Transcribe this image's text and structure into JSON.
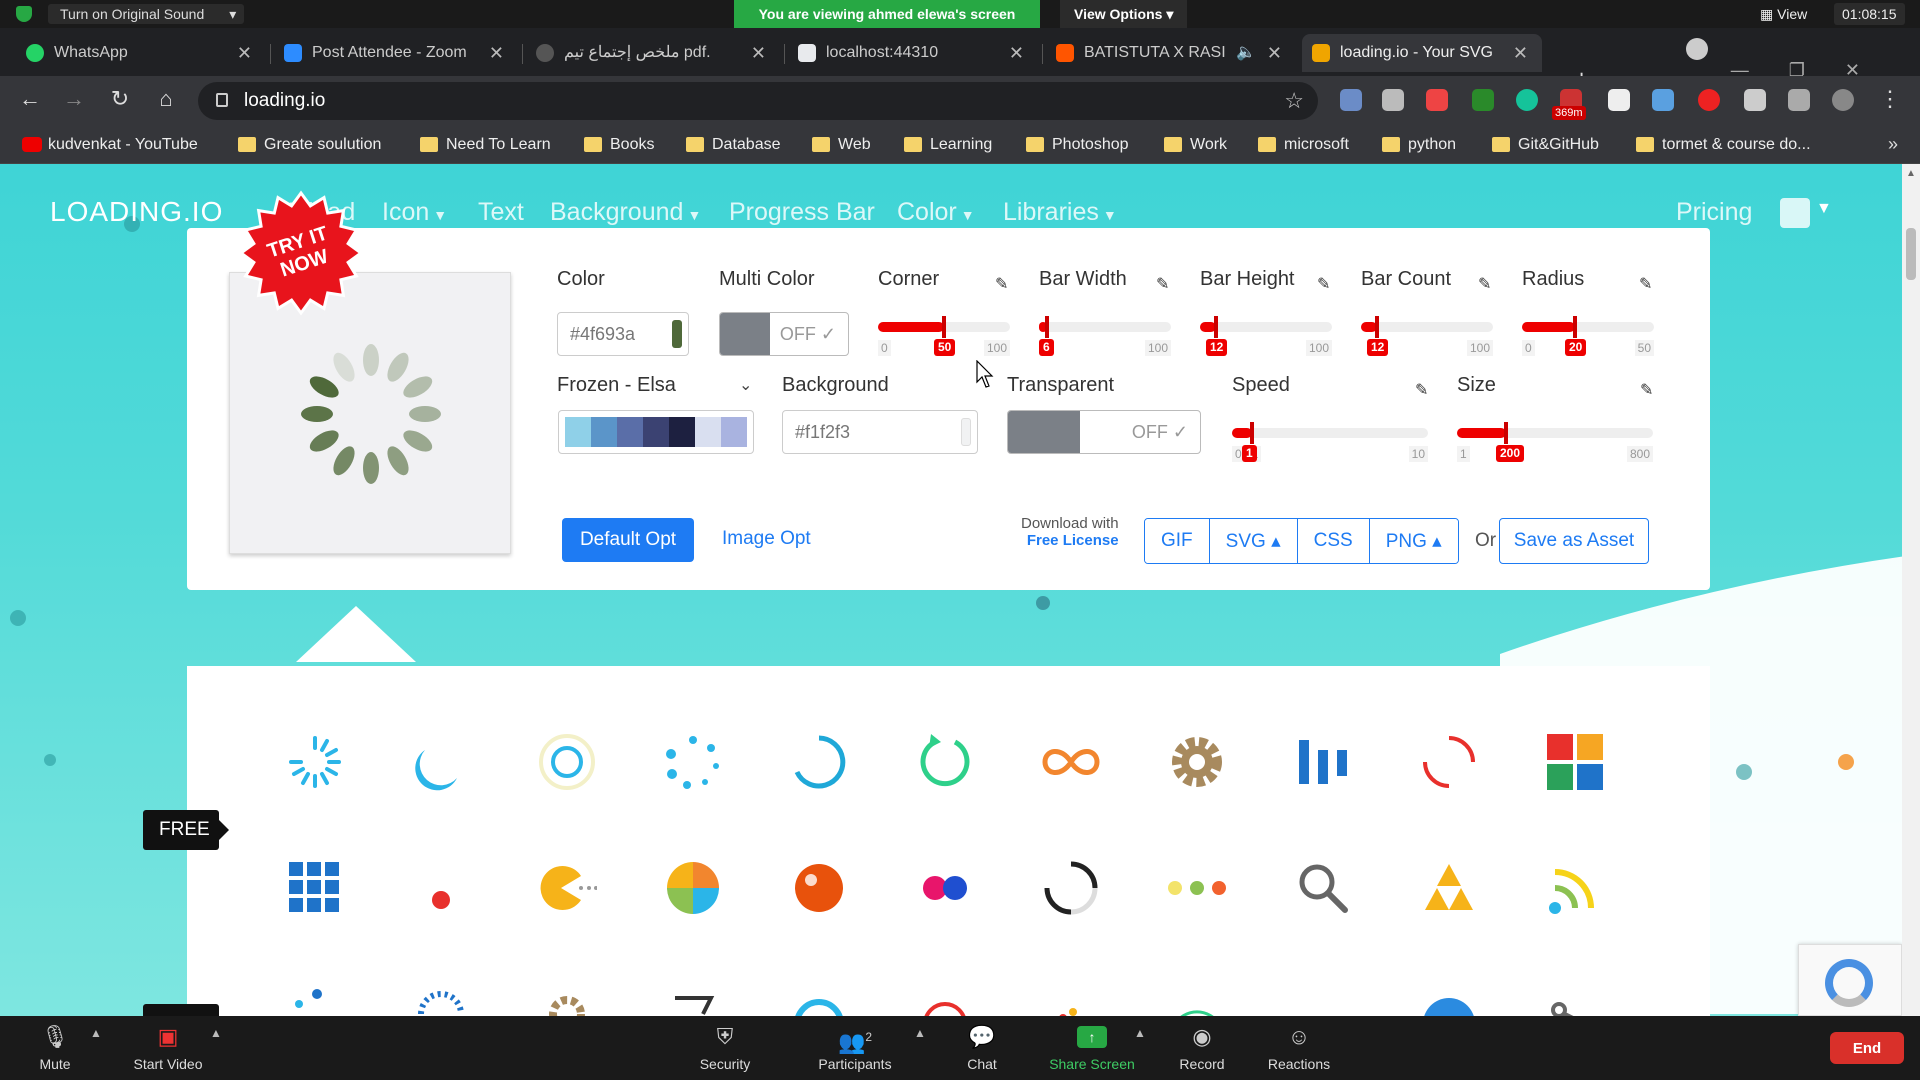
{
  "zoom_top": {
    "original_sound": "Turn on Original Sound",
    "viewing_banner": "You are viewing ahmed elewa's screen",
    "view_options": "View Options",
    "view": "View",
    "clock": "01:08:15"
  },
  "tabs": [
    {
      "label": "WhatsApp",
      "favicon_color": "#25d366"
    },
    {
      "label": "Post Attendee - Zoom",
      "favicon_color": "#2d8cff"
    },
    {
      "label": "ملخص إجتماع تيم pdf.",
      "favicon_color": "#555555"
    },
    {
      "label": "localhost:44310",
      "favicon_color": "#e8eaed"
    },
    {
      "label": "BATISTUTA X RASI",
      "favicon_color": "#ff5500"
    },
    {
      "label": "loading.io - Your SVG",
      "favicon_color": "#f0a500"
    }
  ],
  "address": {
    "url": "loading.io",
    "ext_badge": "369m"
  },
  "bookmarks": [
    "kudvenkat - YouTube",
    "Greate soulution",
    "Need To Learn",
    "Books",
    "Database",
    "Web",
    "Learning",
    "Photoshop",
    "Work",
    "microsoft",
    "python",
    "Git&GitHub",
    "tormet & course do..."
  ],
  "site": {
    "logo": "LOADING.IO",
    "nav": [
      "Upload",
      "Icon",
      "Text",
      "Background",
      "Progress Bar",
      "Color",
      "Libraries"
    ],
    "pricing": "Pricing",
    "try_badge_l1": "TRY IT",
    "try_badge_l2": "NOW"
  },
  "editor": {
    "color_label": "Color",
    "color_value": "#4f693a",
    "multicolor_label": "Multi Color",
    "multicolor_value": "OFF",
    "corner": {
      "label": "Corner",
      "min": "0",
      "max": "100",
      "value": "50",
      "level": 0.5
    },
    "bar_width": {
      "label": "Bar Width",
      "min": "",
      "max": "100",
      "value": "6",
      "level": 0.06
    },
    "bar_height": {
      "label": "Bar Height",
      "min": "",
      "max": "100",
      "value": "12",
      "level": 0.12
    },
    "bar_count": {
      "label": "Bar Count",
      "min": "",
      "max": "100",
      "value": "12",
      "level": 0.12
    },
    "radius": {
      "label": "Radius",
      "min": "0",
      "max": "50",
      "value": "20",
      "level": 0.4
    },
    "palette_label": "Frozen - Elsa",
    "palette": [
      "#8fd0e8",
      "#5b95c9",
      "#5a6ea8",
      "#3b4272",
      "#1d2040",
      "#d9dff0",
      "#a9b3e0"
    ],
    "background_label": "Background",
    "background_value": "#f1f2f3",
    "transparent_label": "Transparent",
    "transparent_value": "OFF",
    "speed": {
      "label": "Speed",
      "min": "0.01",
      "max": "10",
      "value": "1",
      "level": 0.1
    },
    "size": {
      "label": "Size",
      "min": "1",
      "max": "800",
      "value": "200",
      "level": 0.25
    },
    "default_opt": "Default Opt",
    "image_opt": "Image Opt",
    "download_with": "Download with",
    "free_license": "Free License",
    "download_buttons": [
      "GIF",
      "SVG ▴",
      "CSS",
      "PNG ▴"
    ],
    "or": "Or",
    "save_asset": "Save as Asset",
    "spinner_color": "#4f693a"
  },
  "gallery": {
    "free_tag": "FREE"
  },
  "zoom_bar": {
    "mute": "Mute",
    "start_video": "Start Video",
    "security": "Security",
    "participants": "Participants",
    "participants_count": "2",
    "chat": "Chat",
    "share_screen": "Share Screen",
    "record": "Record",
    "reactions": "Reactions",
    "end": "End"
  }
}
